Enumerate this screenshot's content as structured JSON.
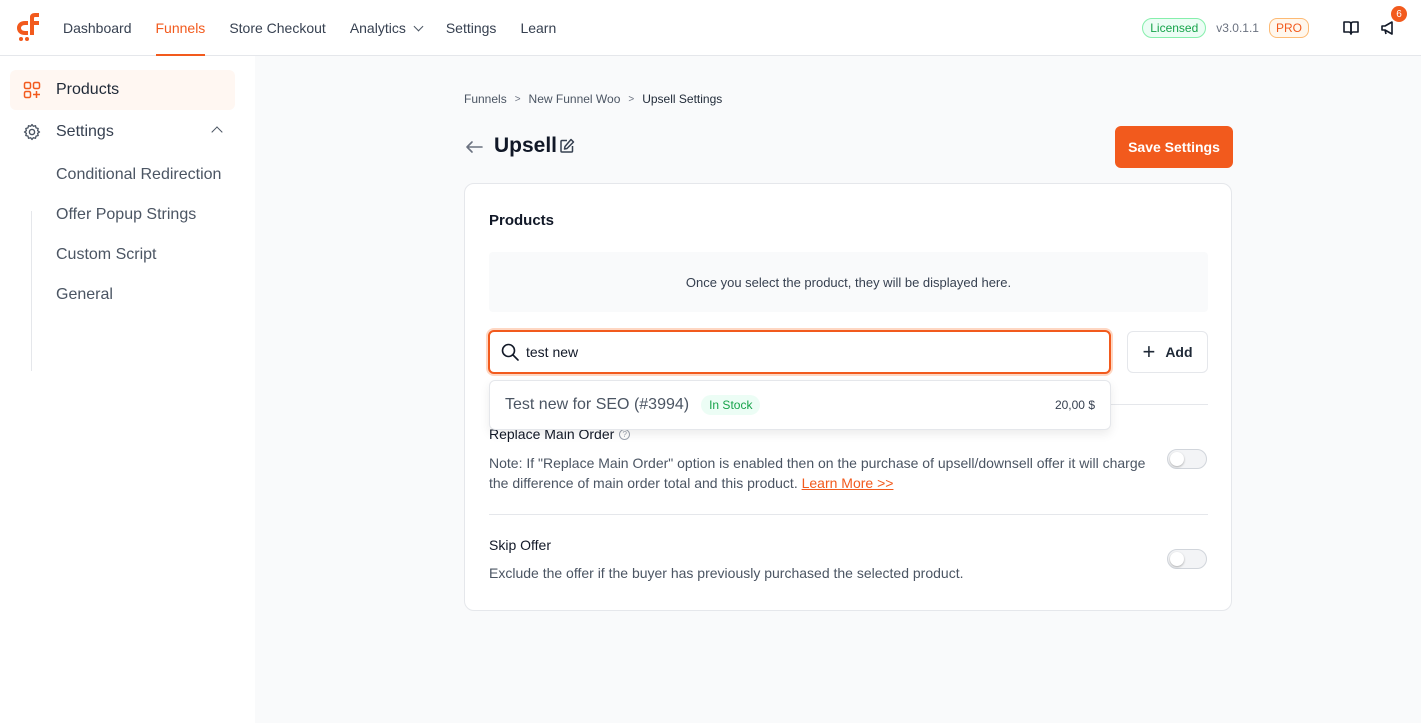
{
  "nav": {
    "items": [
      {
        "label": "Dashboard",
        "active": false
      },
      {
        "label": "Funnels",
        "active": true
      },
      {
        "label": "Store Checkout",
        "active": false
      },
      {
        "label": "Analytics",
        "active": false,
        "has_dropdown": true
      },
      {
        "label": "Settings",
        "active": false
      },
      {
        "label": "Learn",
        "active": false
      }
    ],
    "licensed": "Licensed",
    "version": "v3.0.1.1",
    "pro": "PRO",
    "notification_count": "6"
  },
  "sidebar": {
    "products": "Products",
    "settings": "Settings",
    "sub_items": [
      "Conditional Redirection",
      "Offer Popup Strings",
      "Custom Script",
      "General"
    ]
  },
  "breadcrumb": {
    "items": [
      "Funnels",
      "New Funnel Woo",
      "Upsell Settings"
    ],
    "separator": ">"
  },
  "page": {
    "title": "Upsell",
    "save_label": "Save Settings"
  },
  "products_card": {
    "title": "Products",
    "empty_text": "Once you select the product, they will be displayed here.",
    "search_value": "test new",
    "add_label": "Add"
  },
  "dropdown": {
    "name": "Test new for SEO (#3994)",
    "stock": "In Stock",
    "price": "20,00 $"
  },
  "options": {
    "replace": {
      "title": "Replace Main Order",
      "desc": "Note: If \"Replace Main Order\" option is enabled then on the purchase of upsell/downsell offer it will charge the difference of main order total and this product.",
      "link": "Learn More >>",
      "enabled": false
    },
    "skip": {
      "title": "Skip Offer",
      "desc": "Exclude the offer if the buyer has previously purchased the selected product.",
      "enabled": false
    }
  },
  "colors": {
    "accent": "#f25a1d",
    "success": "#16a34a"
  },
  "icons": [
    "logo-icon",
    "chevron-down-icon",
    "book-icon",
    "megaphone-icon",
    "grid-icon",
    "gear-icon",
    "chevron-up-icon",
    "back-arrow-icon",
    "edit-icon",
    "search-icon",
    "plus-icon",
    "help-icon"
  ]
}
